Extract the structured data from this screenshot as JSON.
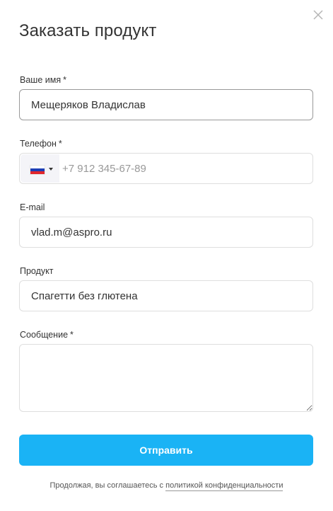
{
  "modal": {
    "title": "Заказать продукт",
    "close_icon": "close-icon"
  },
  "form": {
    "name": {
      "label": "Ваше имя",
      "required_mark": "*",
      "value": "Мещеряков Владислав"
    },
    "phone": {
      "label": "Телефон",
      "required_mark": "*",
      "placeholder": "+7 912 345-67-89",
      "country_flag": "russia-flag-icon",
      "flag_colors": [
        "#ffffff",
        "#1c3fb5",
        "#e0262d"
      ]
    },
    "email": {
      "label": "E-mail",
      "value": "vlad.m@aspro.ru"
    },
    "product": {
      "label": "Продукт",
      "value": "Спагетти без глютена"
    },
    "message": {
      "label": "Сообщение",
      "required_mark": "*",
      "value": ""
    },
    "submit_label": "Отправить"
  },
  "consent": {
    "text": "Продолжая, вы соглашаетесь с",
    "link_text": "политикой конфиденциальности"
  },
  "colors": {
    "accent": "#1ab3f5",
    "text": "#333333",
    "border": "#dedede",
    "flag_bg": "#f4f4f8"
  }
}
